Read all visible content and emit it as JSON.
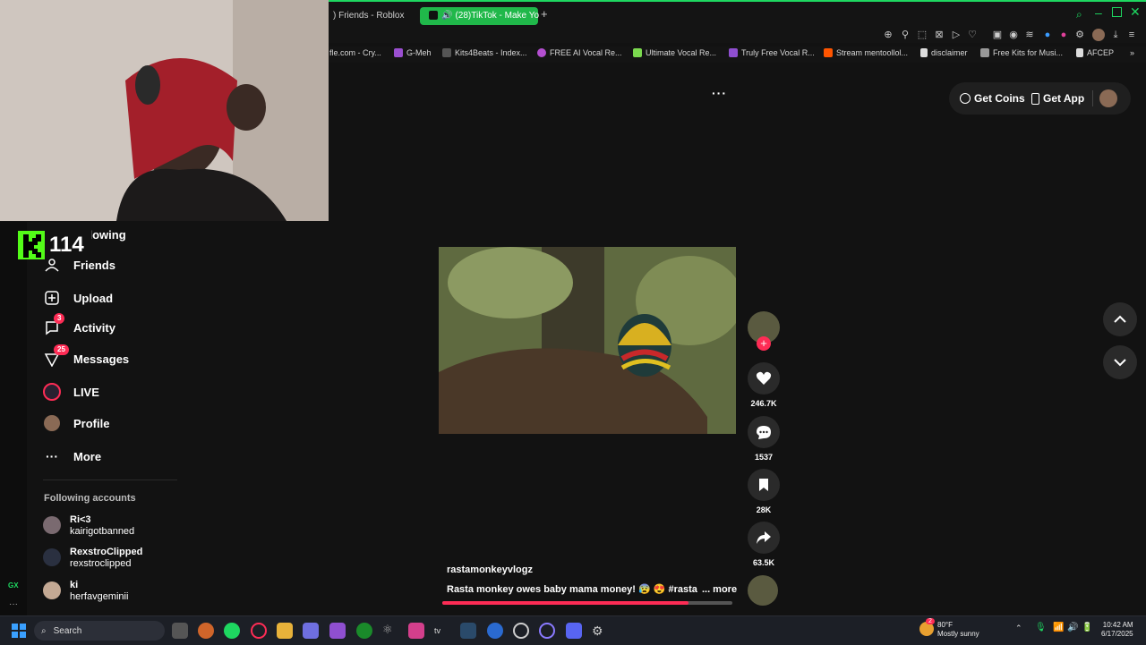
{
  "browser": {
    "tabs": [
      {
        "label": ") Friends - Roblox",
        "active": false
      },
      {
        "label": "(28)TikTok - Make Yo",
        "active": true
      }
    ],
    "new_tab": "+",
    "bookmarks": [
      {
        "label": "fle.com - Cry...",
        "color": "#888888"
      },
      {
        "label": "G-Meh",
        "color": "#9a4fd0"
      },
      {
        "label": "Kits4Beats - Index...",
        "color": "#cccccc"
      },
      {
        "label": "FREE AI Vocal Re...",
        "color": "#b44fd0"
      },
      {
        "label": "Ultimate Vocal Re...",
        "color": "#7bd94f"
      },
      {
        "label": "Truly Free Vocal R...",
        "color": "#8f4fd0"
      },
      {
        "label": "Stream mentoollol...",
        "color": "#ff5500"
      },
      {
        "label": "disclaimer",
        "color": "#dddddd"
      },
      {
        "label": "Free Kits for Musi...",
        "color": "#bbbbbb"
      },
      {
        "label": "AFCEP",
        "color": "#dddddd"
      }
    ]
  },
  "overlay": {
    "kick_count": "114"
  },
  "sidebar": {
    "items": [
      {
        "label": "Following",
        "icon": "following-icon",
        "badge": ""
      },
      {
        "label": "Friends",
        "icon": "friends-icon",
        "badge": ""
      },
      {
        "label": "Upload",
        "icon": "upload-icon",
        "badge": ""
      },
      {
        "label": "Activity",
        "icon": "activity-icon",
        "badge": "3"
      },
      {
        "label": "Messages",
        "icon": "messages-icon",
        "badge": "25"
      },
      {
        "label": "LIVE",
        "icon": "live-icon",
        "badge": ""
      },
      {
        "label": "Profile",
        "icon": "profile-icon",
        "badge": ""
      },
      {
        "label": "More",
        "icon": "more-icon",
        "badge": ""
      }
    ],
    "following_title": "Following accounts",
    "accounts": [
      {
        "name": "Ri<3",
        "handle": "kairigotbanned"
      },
      {
        "name": "RexstroClipped",
        "handle": "rexstroclipped"
      },
      {
        "name": "ki",
        "handle": "herfavgeminii"
      }
    ]
  },
  "header": {
    "get_coins": "Get Coins",
    "get_app": "Get App"
  },
  "post": {
    "username": "rastamonkeyvlogz",
    "caption": "Rasta monkey owes baby mama money! 😰 😍 #rasta",
    "more": "... more",
    "likes": "246.7K",
    "comments": "1537",
    "saves": "28K",
    "shares": "63.5K",
    "progress": 0.85
  },
  "taskbar": {
    "search": "Search",
    "weather_temp": "80°F",
    "weather_desc": "Mostly sunny",
    "weather_badge": "2",
    "time": "10:42 AM",
    "date": "6/17/2025"
  }
}
